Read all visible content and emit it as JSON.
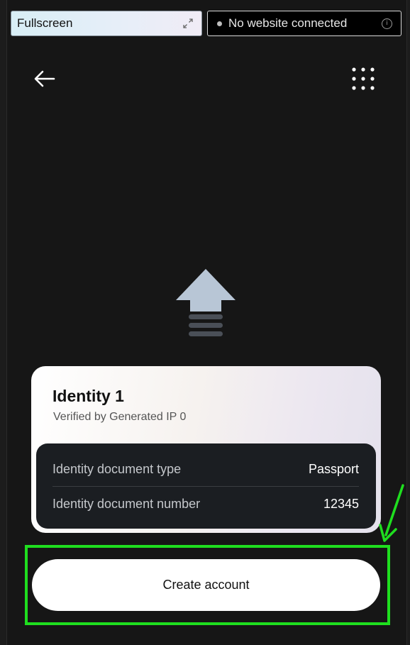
{
  "topbar": {
    "fullscreen_label": "Fullscreen",
    "status_text": "No website connected",
    "info_glyph": "i"
  },
  "icons": {
    "back": "arrow-left-icon",
    "menu": "grid-dots-icon",
    "expand": "expand-icon",
    "identity": "identity-arrow-icon"
  },
  "identity_card": {
    "title": "Identity 1",
    "subtitle": "Verified by Generated IP 0",
    "details": [
      {
        "label": "Identity document type",
        "value": "Passport"
      },
      {
        "label": "Identity document number",
        "value": "12345"
      }
    ]
  },
  "actions": {
    "create_account_label": "Create account"
  },
  "colors": {
    "background": "#161616",
    "accent_highlight": "#1fde1f",
    "graphic": "#b8c6d6",
    "details_bg": "#1b1e22"
  }
}
